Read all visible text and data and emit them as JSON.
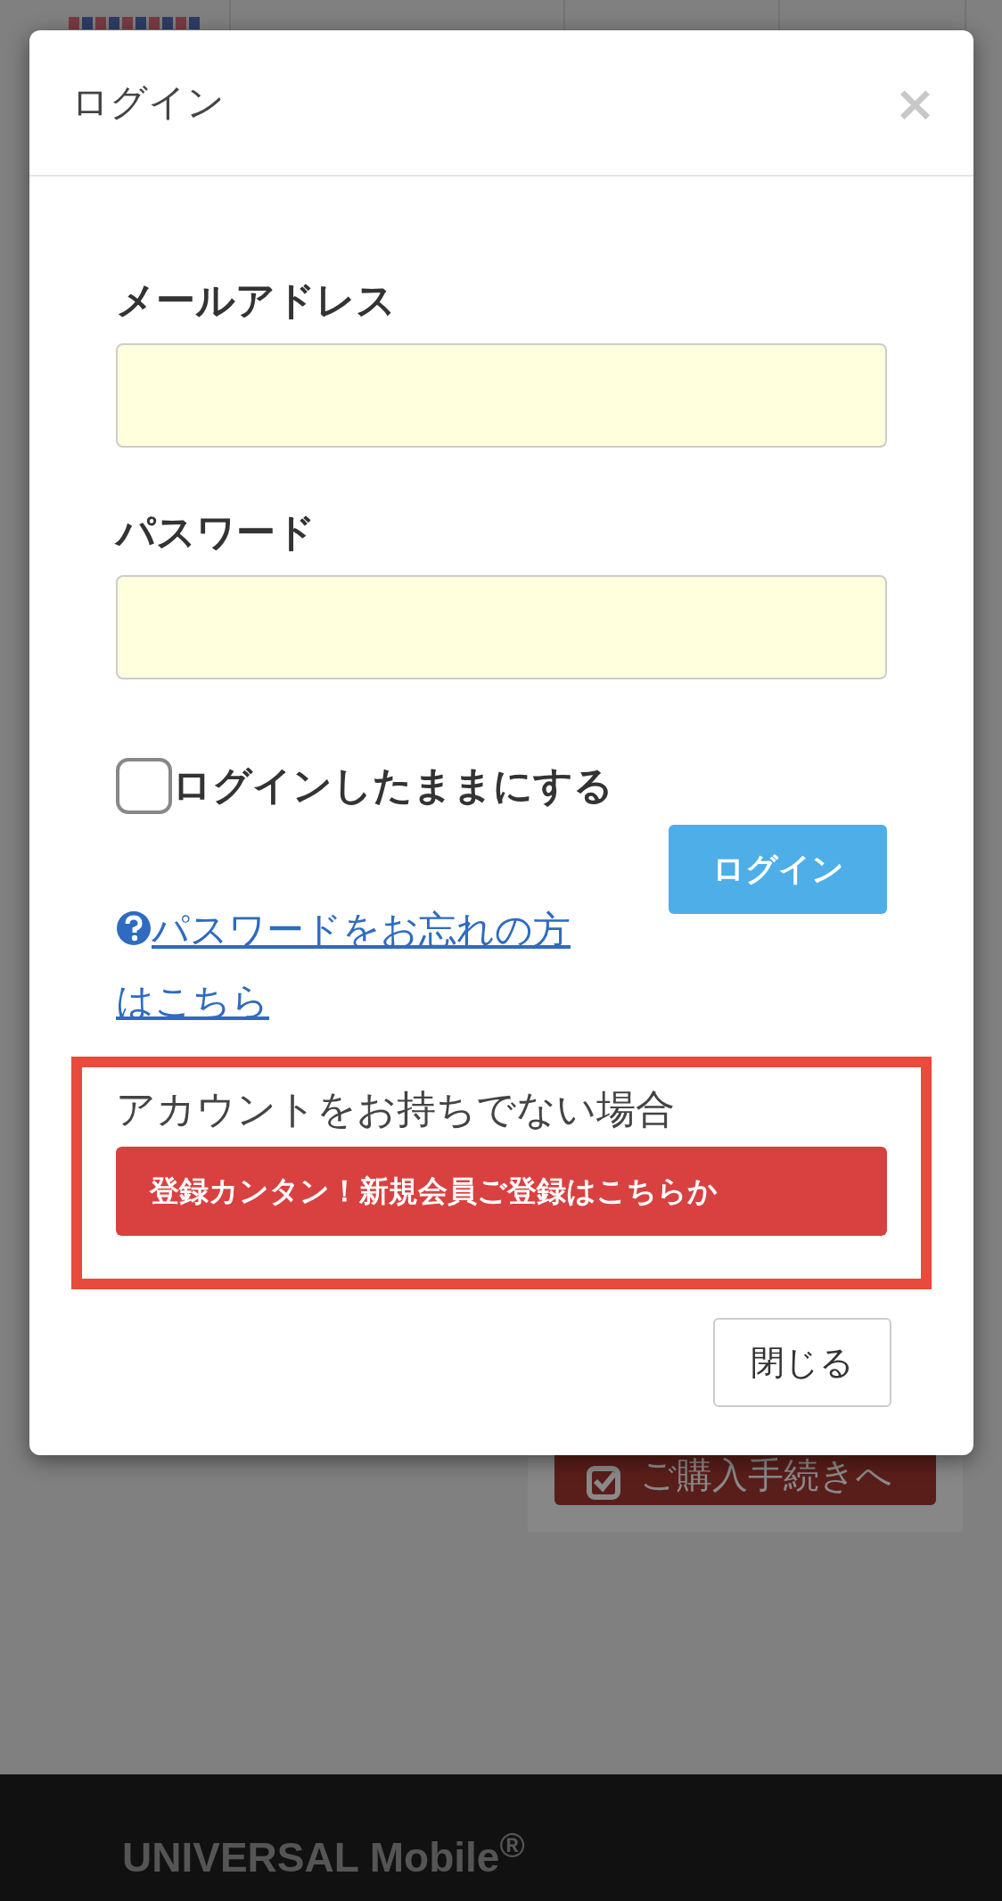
{
  "background": {
    "purchase_button": "ご購入手続きへ",
    "footer_brand": "UNIVERSAL Mobile$^{®}$"
  },
  "modal": {
    "title": "ログイン",
    "close": "×",
    "fields": [
      {
        "label": "メールアドレス"
      },
      {
        "label": "パスワード"
      }
    ],
    "remember": {
      "label": "ログインしたままにする",
      "checked": false
    },
    "login_button": "ログイン",
    "forgot_link": "パスワードをお忘れの方はこちら",
    "signup_section": {
      "highlighted": true,
      "prompt": "アカウントをお持ちでない場合",
      "button": "登録カンタン！新規会員ご登録はこちらか"
    },
    "close_button": "閉じる"
  }
}
